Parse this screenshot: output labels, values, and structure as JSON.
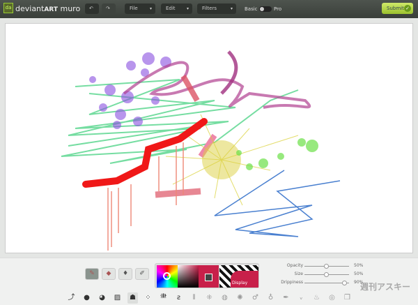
{
  "app": {
    "logo": "da",
    "brand_light": "deviant",
    "brand_bold": "ART",
    "brand_suffix": " muro"
  },
  "toolbar": {
    "undo_icon": "↶",
    "redo_icon": "↷",
    "menus": [
      {
        "label": "File"
      },
      {
        "label": "Edit"
      },
      {
        "label": "Filters"
      }
    ],
    "mode_left": "Basic",
    "mode_right": "Pro",
    "mode_pro": false,
    "submit": "Submit",
    "caret": "▾"
  },
  "tools": [
    {
      "name": "brush",
      "icon": "✎",
      "active": true
    },
    {
      "name": "eraser",
      "icon": "◆",
      "active": false
    },
    {
      "name": "fill",
      "icon": "♦",
      "active": false
    },
    {
      "name": "eyedropper",
      "icon": "✐",
      "active": false
    }
  ],
  "colors": {
    "primary": "#c8204a",
    "pattern_label": "Display"
  },
  "sliders": [
    {
      "label": "Opacity",
      "value": 50,
      "display": "50%"
    },
    {
      "label": "Size",
      "value": 50,
      "display": "50%"
    },
    {
      "label": "Drippiness",
      "value": 90,
      "display": "90%"
    }
  ],
  "brushes": [
    "⤴",
    "●",
    "◕",
    "▨",
    "☗",
    "⁘",
    "⺻",
    "ƨ",
    "⫴",
    "⁜",
    "◍",
    "✺",
    "♂",
    "♁",
    "✒",
    "ᵥ",
    "♨",
    "◎",
    "❒"
  ],
  "active_brush": 4,
  "watermark": "週刊アスキー"
}
